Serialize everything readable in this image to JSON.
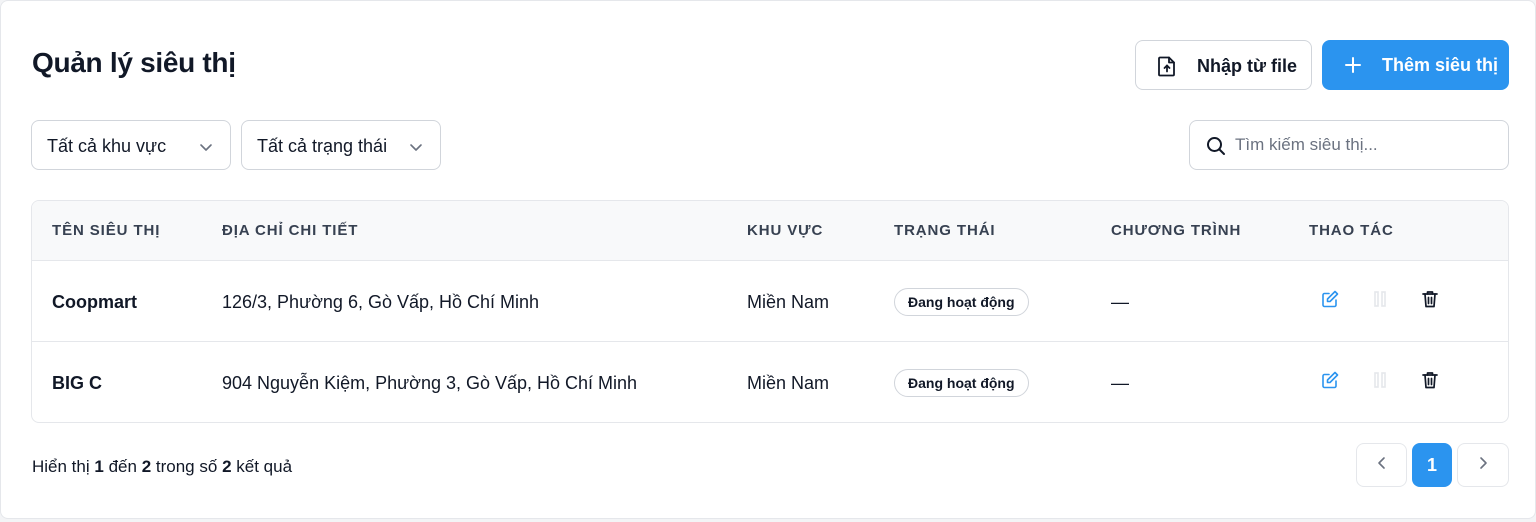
{
  "header": {
    "title": "Quản lý siêu thị",
    "import_label": "Nhập từ file",
    "add_label": "Thêm siêu thị"
  },
  "filters": {
    "region_selected": "Tất cả khu vực",
    "status_selected": "Tất cả trạng thái",
    "search_placeholder": "Tìm kiếm siêu thị..."
  },
  "table": {
    "columns": [
      "TÊN SIÊU THỊ",
      "ĐỊA CHỈ CHI TIẾT",
      "KHU VỰC",
      "TRẠNG THÁI",
      "CHƯƠNG TRÌNH",
      "THAO TÁC"
    ],
    "rows": [
      {
        "name": "Coopmart",
        "address": "126/3, Phường 6, Gò Vấp, Hồ Chí Minh",
        "region": "Miền Nam",
        "status": "Đang hoạt động",
        "program": "—"
      },
      {
        "name": "BIG C",
        "address": "904 Nguyễn Kiệm, Phường 3, Gò Vấp, Hồ Chí Minh",
        "region": "Miền Nam",
        "status": "Đang hoạt động",
        "program": "—"
      }
    ]
  },
  "footer": {
    "summary_prefix": "Hiển thị",
    "from": "1",
    "summary_to": "đến",
    "to": "2",
    "summary_of": "trong số",
    "total": "2",
    "summary_suffix": "kết quả",
    "current_page": "1"
  },
  "colors": {
    "primary": "#2b94ef",
    "edit_icon": "#2b94ef",
    "disabled_icon": "#e5e7eb",
    "delete_icon": "#111827"
  },
  "icons": {
    "import": "file-upload-icon",
    "add": "plus-icon",
    "dropdown": "chevron-down-icon",
    "search": "search-icon",
    "edit": "edit-icon",
    "toggle": "pause-icon",
    "delete": "trash-icon",
    "prev": "chevron-left-icon",
    "next": "chevron-right-icon"
  }
}
